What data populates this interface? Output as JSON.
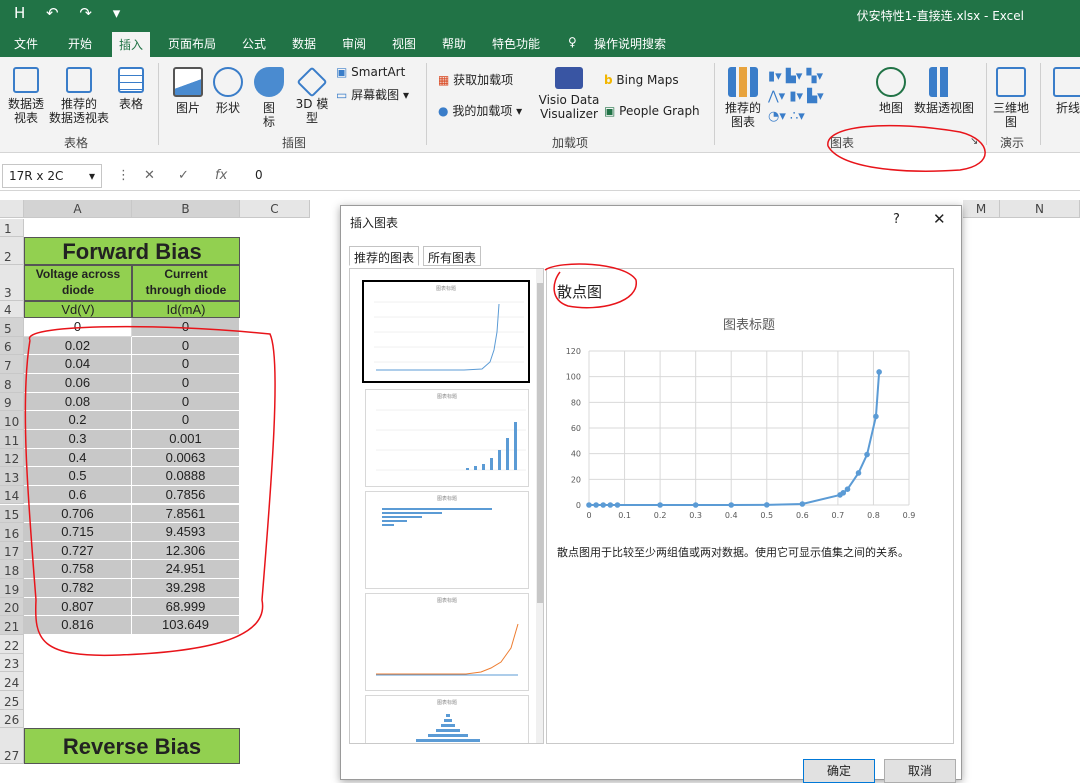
{
  "title_bar": {
    "quick_access": "H ↶ ↷ ▾",
    "title": "伏安特性1-直接连.xlsx  -  Excel"
  },
  "tabs": [
    "文件",
    "开始",
    "插入",
    "页面布局",
    "公式",
    "数据",
    "审阅",
    "视图",
    "帮助",
    "特色功能"
  ],
  "active_tab": "插入",
  "tell_me": "操作说明搜索",
  "ribbon": {
    "tables": [
      "数据透\n视表",
      "推荐的\n数据透视表",
      "表格"
    ],
    "tables_group": "表格",
    "illustrations": [
      "图片",
      "形状",
      "图\n标",
      "3D 模\n型"
    ],
    "smartart": "SmartArt",
    "screenshot": "屏幕截图",
    "illustrations_group": "插图",
    "addins": [
      "获取加载项",
      "我的加载项"
    ],
    "visio": "Visio Data\nVisualizer",
    "bing": "Bing Maps",
    "people": "People Graph",
    "addins_group": "加载项",
    "rec_charts": "推荐的\n图表",
    "map": "地图",
    "pivot_chart": "数据透视图",
    "charts_group": "图表",
    "map3d": "三维地\n图",
    "tour_group": "演示",
    "sparkline": "折线"
  },
  "formula_bar": {
    "name_box": "17R x 2C",
    "value": "0"
  },
  "columns": [
    "A",
    "B",
    "C",
    "M",
    "N"
  ],
  "sheet": {
    "forward_title": "Forward Bias",
    "header_a": "Voltage across\ndiode",
    "header_b": "Current\nthrough diode",
    "unit_a": "Vd(V)",
    "unit_b": "Id(mA)",
    "voltages": [
      "0",
      "0.02",
      "0.04",
      "0.06",
      "0.08",
      "0.2",
      "0.3",
      "0.4",
      "0.5",
      "0.6",
      "0.706",
      "0.715",
      "0.727",
      "0.758",
      "0.782",
      "0.807",
      "0.816"
    ],
    "currents": [
      "0",
      "0",
      "0",
      "0",
      "0",
      "0",
      "0.001",
      "0.0063",
      "0.0888",
      "0.7856",
      "7.8561",
      "9.4593",
      "12.306",
      "24.951",
      "39.298",
      "68.999",
      "103.649"
    ],
    "reverse_title": "Reverse Bias",
    "row_numbers": [
      "1",
      "2",
      "3",
      "4",
      "5",
      "6",
      "7",
      "8",
      "9",
      "10",
      "11",
      "12",
      "13",
      "14",
      "15",
      "16",
      "17",
      "18",
      "19",
      "20",
      "21",
      "22",
      "23",
      "24",
      "25",
      "26",
      "27"
    ]
  },
  "dialog": {
    "title": "插入图表",
    "help": "?",
    "close": "✕",
    "tab_recommended": "推荐的图表",
    "tab_all": "所有图表",
    "chart_type_name": "散点图",
    "description": "散点图用于比较至少两组值或两对数据。使用它可显示值集之间的关系。",
    "ok": "确定",
    "cancel": "取消"
  },
  "chart_data": {
    "type": "scatter",
    "title": "图表标题",
    "x": [
      0,
      0.02,
      0.04,
      0.06,
      0.08,
      0.2,
      0.3,
      0.4,
      0.5,
      0.6,
      0.706,
      0.715,
      0.727,
      0.758,
      0.782,
      0.807,
      0.816
    ],
    "y": [
      0,
      0,
      0,
      0,
      0,
      0,
      0.001,
      0.0063,
      0.0888,
      0.7856,
      7.8561,
      9.4593,
      12.306,
      24.951,
      39.298,
      68.999,
      103.649
    ],
    "xlim": [
      0,
      0.9
    ],
    "ylim": [
      0,
      120
    ],
    "xticks": [
      "0",
      "0.1",
      "0.2",
      "0.3",
      "0.4",
      "0.5",
      "0.6",
      "0.7",
      "0.8",
      "0.9"
    ],
    "yticks": [
      "0",
      "20",
      "40",
      "60",
      "80",
      "100",
      "120"
    ],
    "grid": true,
    "color": "#5b9bd5"
  },
  "thumbs": [
    "图表标题",
    "图表标题",
    "图表标题",
    "图表标题",
    "图表标题"
  ],
  "colors": {
    "excel_green": "#217346",
    "cell_green": "#92d050",
    "annotation_red": "#e8141a"
  }
}
